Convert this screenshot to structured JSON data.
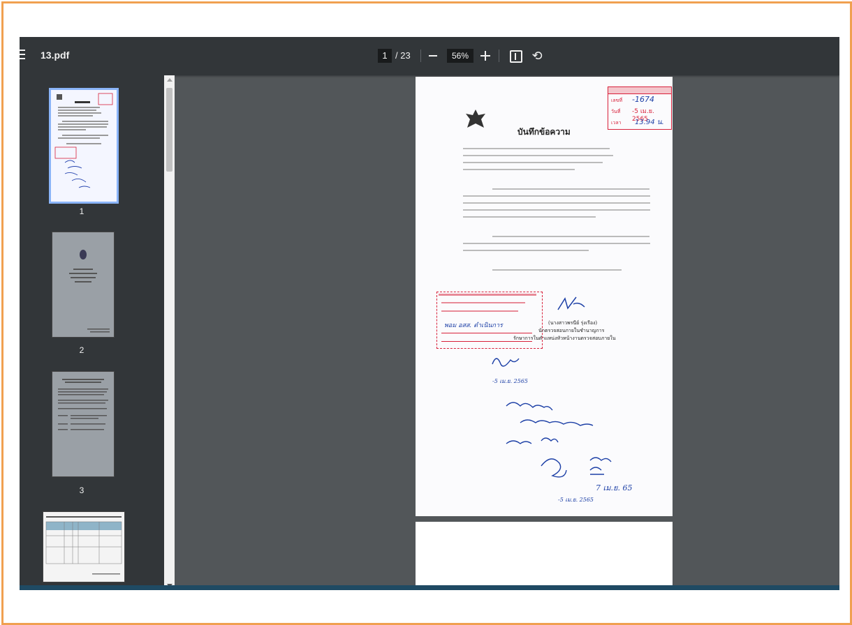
{
  "toolbar": {
    "file_name": "13.pdf",
    "current_page": "1",
    "total_pages": "/ 23",
    "zoom": "56%"
  },
  "thumbnails": [
    {
      "label": "1"
    },
    {
      "label": "2"
    },
    {
      "label": "3"
    }
  ],
  "document": {
    "stamp": {
      "line1": "-1674",
      "line2": "-5 เม.ย. 2565",
      "line3": "13.94 น."
    },
    "title": "บันทึกข้อความ",
    "side_stamp_text": "พอม อสส. ดำเนินการ",
    "signature_name": "(นางสาวพรนีย์ รุ่งเรือง)",
    "signature_role1": "นักตรวจสอบภายในชำนาญการ",
    "signature_role2": "รักษาการในตำแหน่งหัวหน้างานตรวจสอบภายใน",
    "hand_date1": "-5 เม.ย. 2565",
    "hand_date2": "-5 เม.ย. 2565",
    "hand_date3": "7 เม.ย. 65"
  }
}
